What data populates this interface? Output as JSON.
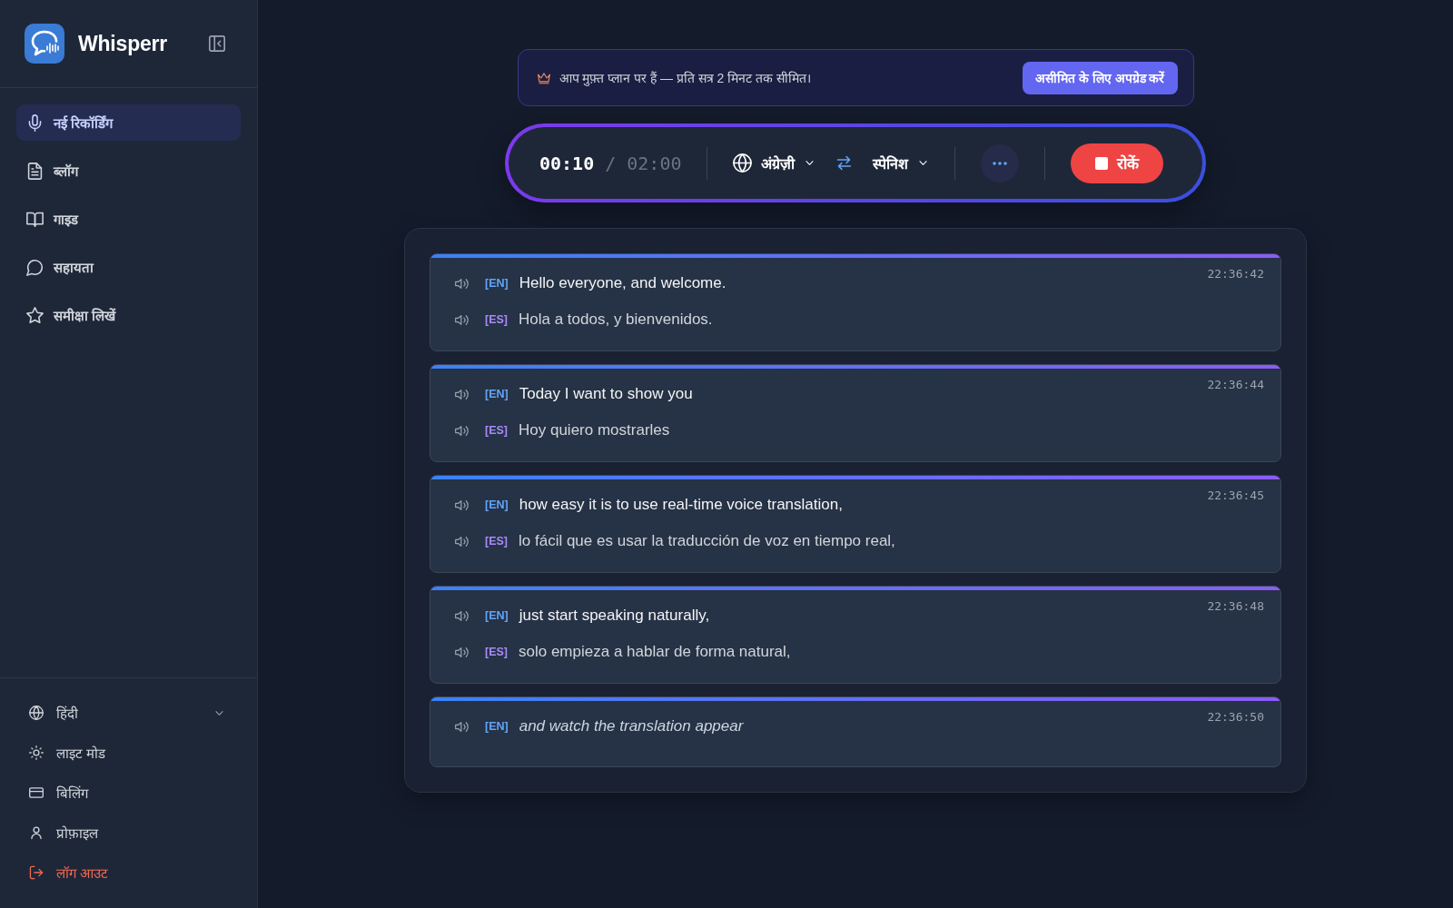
{
  "sidebar": {
    "brand": "Whisperr",
    "nav": [
      {
        "label": "नई रिकॉर्डिंग",
        "selected": true
      },
      {
        "label": "ब्लॉग",
        "selected": false
      },
      {
        "label": "गाइड",
        "selected": false
      },
      {
        "label": "सहायता",
        "selected": false
      },
      {
        "label": "समीक्षा लिखें",
        "selected": false
      }
    ],
    "footer": [
      {
        "label": "हिंदी",
        "kind": "dropdown"
      },
      {
        "label": "लाइट मोड",
        "kind": "link"
      },
      {
        "label": "बिलिंग",
        "kind": "link"
      },
      {
        "label": "प्रोफ़ाइल",
        "kind": "link"
      },
      {
        "label": "लॉग आउट",
        "kind": "danger"
      }
    ]
  },
  "banner": {
    "text": "आप मुफ़्त प्लान पर हैं — प्रति सत्र 2 मिनट तक सीमित।",
    "button": "असीमित के लिए अपग्रेड करें"
  },
  "recorder": {
    "elapsed": "00:10",
    "separator": "/",
    "limit": "02:00",
    "source_language": "अंग्रेज़ी",
    "target_language": "स्पेनिश",
    "stop_button": "रोकें"
  },
  "transcript": [
    {
      "time": "22:36:42",
      "interim": false,
      "lines": [
        {
          "tag": "[EN]",
          "kind": "source",
          "text": "Hello everyone, and welcome."
        },
        {
          "tag": "[ES]",
          "kind": "translation",
          "text": "Hola a todos, y bienvenidos."
        }
      ]
    },
    {
      "time": "22:36:44",
      "interim": false,
      "lines": [
        {
          "tag": "[EN]",
          "kind": "source",
          "text": "Today I want to show you"
        },
        {
          "tag": "[ES]",
          "kind": "translation",
          "text": "Hoy quiero mostrarles"
        }
      ]
    },
    {
      "time": "22:36:45",
      "interim": false,
      "lines": [
        {
          "tag": "[EN]",
          "kind": "source",
          "text": "how easy it is to use real-time voice translation,"
        },
        {
          "tag": "[ES]",
          "kind": "translation",
          "text": "lo fácil que es usar la traducción de voz en tiempo real,"
        }
      ]
    },
    {
      "time": "22:36:48",
      "interim": false,
      "lines": [
        {
          "tag": "[EN]",
          "kind": "source",
          "text": "just start speaking naturally,"
        },
        {
          "tag": "[ES]",
          "kind": "translation",
          "text": "solo empieza a hablar de forma natural,"
        }
      ]
    },
    {
      "time": "22:36:50",
      "interim": true,
      "lines": [
        {
          "tag": "[EN]",
          "kind": "source",
          "text": "and watch the translation appear"
        }
      ]
    }
  ]
}
